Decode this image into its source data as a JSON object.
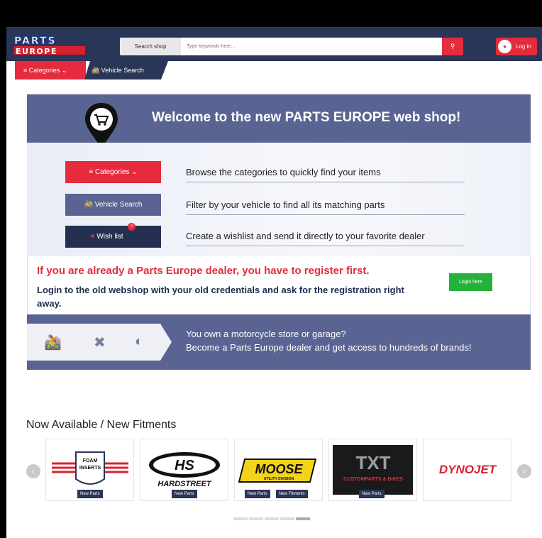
{
  "header": {
    "logo_line1": "PARTS",
    "logo_line2": "EUROPE",
    "search_label": "Search shop",
    "search_placeholder": "Type keywords here...",
    "login_label": "Log in"
  },
  "nav": {
    "categories": "Categories",
    "vehicle_search": "Vehicle Search"
  },
  "hero": {
    "title": "Welcome to the new PARTS EUROPE web shop!",
    "features": [
      {
        "button": "Categories",
        "text": "Browse the categories to quickly find your items"
      },
      {
        "button": "Vehicle Search",
        "text": "Filter by your vehicle to find all its matching parts"
      },
      {
        "button": "Wish list",
        "badge": "0",
        "text": "Create a wishlist and send it directly to your favorite dealer"
      }
    ]
  },
  "register": {
    "title": "If you are already a Parts Europe dealer, you have to register first.",
    "text": "Login to the old webshop with your old credentials and ask for the registration right away.",
    "button": "Login here"
  },
  "dealer": {
    "line1": "You own a motorcycle store or garage?",
    "line2": "Become a Parts Europe dealer and get access to hundreds of brands!"
  },
  "fitments": {
    "title": "Now Available / New Fitments",
    "cards": [
      {
        "brand": "FOAM INSERTS",
        "tags": [
          "New Parts"
        ]
      },
      {
        "brand": "HARDSTREET",
        "tags": [
          "New Parts"
        ]
      },
      {
        "brand": "MOOSE",
        "tags": [
          "New Parts",
          "New Fitments"
        ]
      },
      {
        "brand": "CUSTOMPARTS & BIKES",
        "tags": [
          "New Parts"
        ]
      },
      {
        "brand": "DYNOJET",
        "tags": []
      }
    ]
  },
  "colors": {
    "navy": "#2a3658",
    "red": "#e52b3d",
    "slate": "#5a6492",
    "green": "#23b33b"
  }
}
